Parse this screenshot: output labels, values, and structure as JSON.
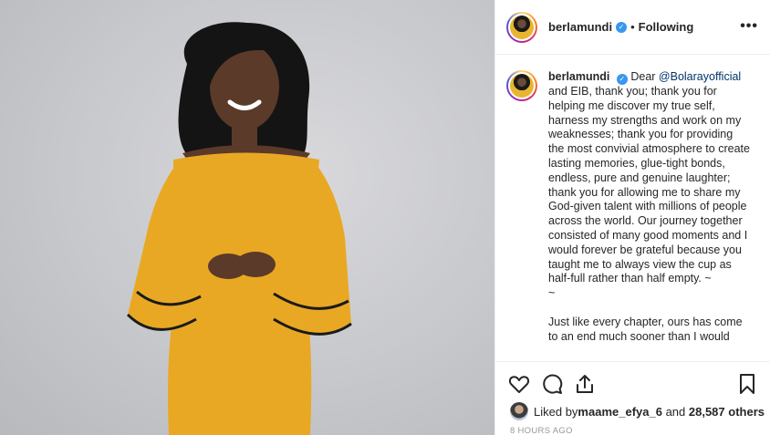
{
  "post": {
    "username": "berlamundi",
    "follow_state": "Following",
    "dot": "•",
    "more": "•••",
    "verified_glyph": "✓"
  },
  "caption": {
    "username": "berlamundi",
    "mention": "@Bolarayofficial",
    "para1_prefix": "Dear ",
    "para1_body": " and EIB, thank you; thank you for helping me discover my true self, harness my strengths and work on my weaknesses; thank you for providing the most convivial atmosphere to create lasting memories, glue-tight bonds, endless, pure and genuine laughter; thank you for allowing me to share my God-given talent with millions of people across the world. Our journey together consisted of many good moments and I would forever be grateful because you taught me to always view the cup as half-full rather than half empty. ~",
    "tilde": "~",
    "para2": "Just like every chapter, ours has come to an end much sooner than I would"
  },
  "likes": {
    "prefix": "Liked by ",
    "user": "maame_efya_6",
    "middle": " and ",
    "count": "28,587 others"
  },
  "timestamp": "8 HOURS AGO",
  "icons": {
    "like": "heart-icon",
    "comment": "comment-icon",
    "share": "share-icon",
    "save": "bookmark-icon"
  },
  "colors": {
    "dress": "#e9a823",
    "verified": "#3897f0",
    "mention": "#003569"
  }
}
